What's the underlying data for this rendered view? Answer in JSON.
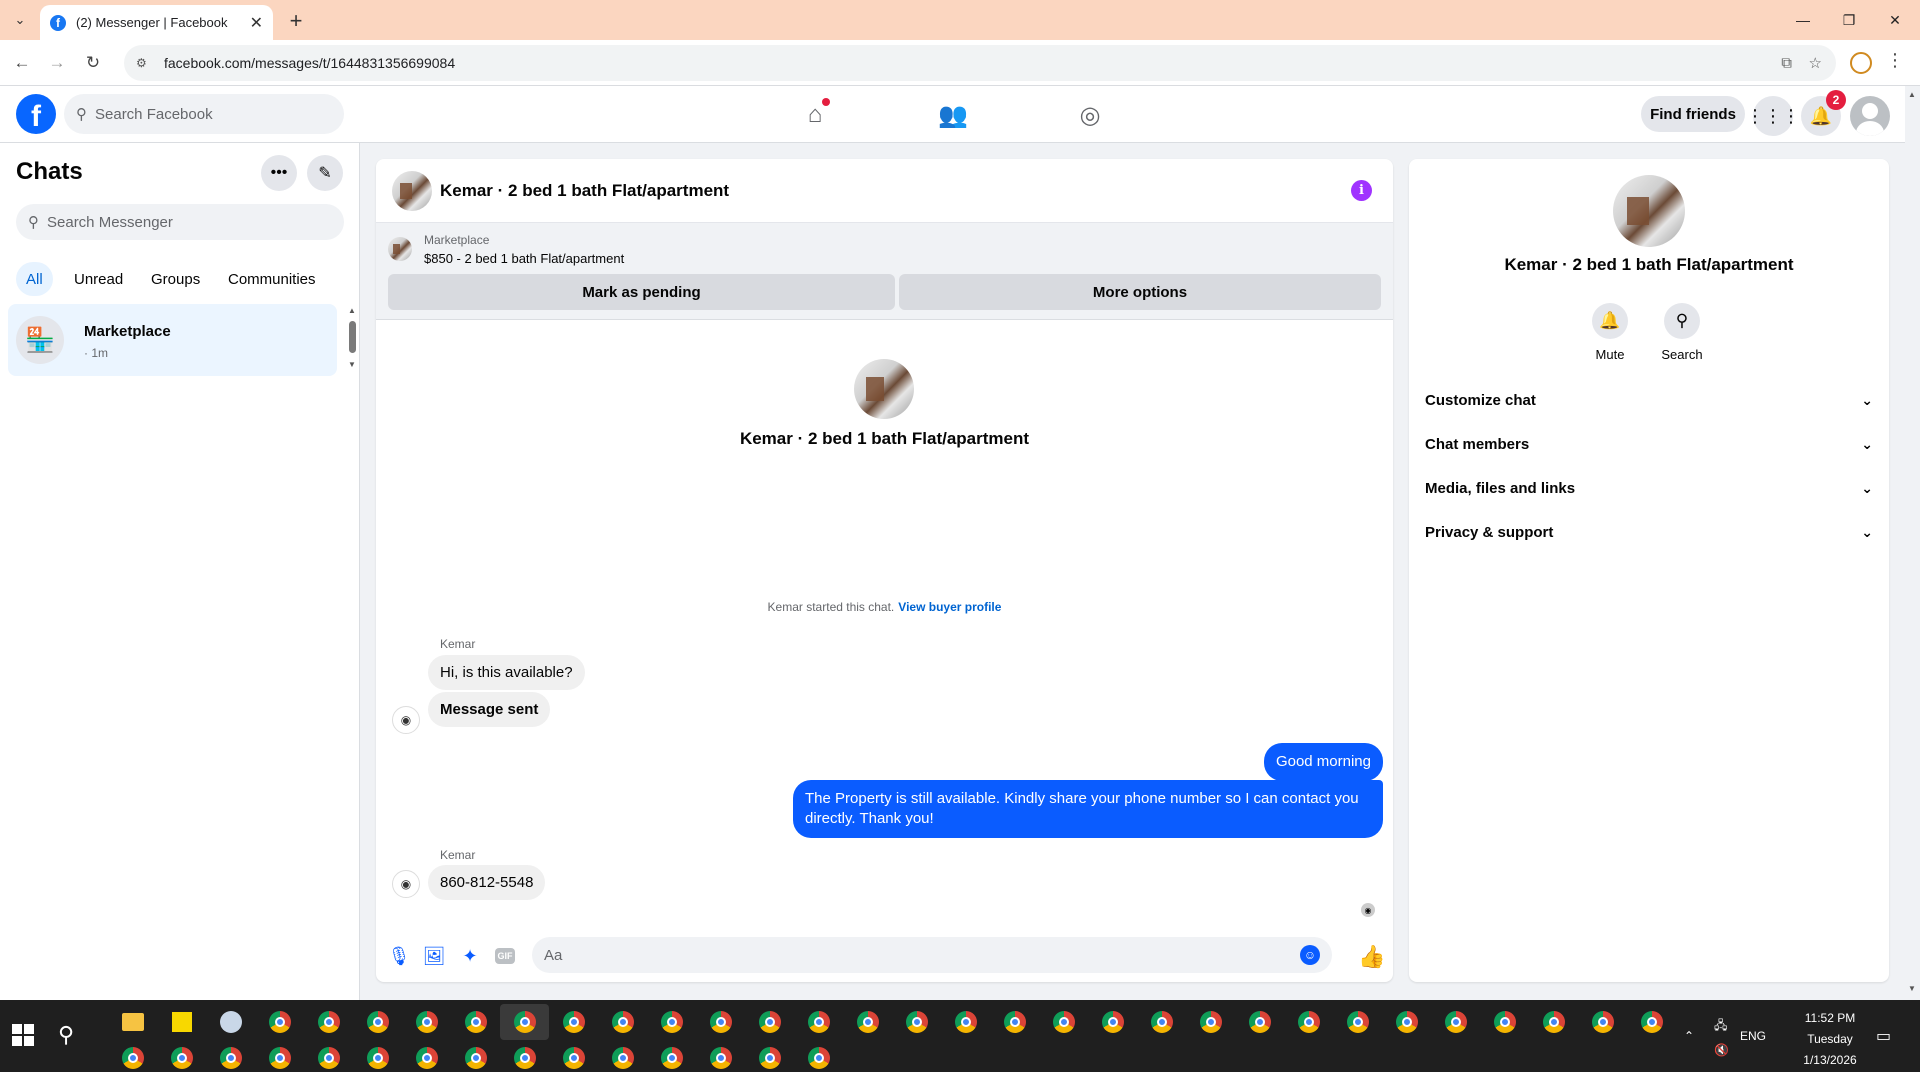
{
  "browser": {
    "tab_title": "(2) Messenger | Facebook",
    "url": "facebook.com/messages/t/1644831356699084"
  },
  "fb": {
    "search_placeholder": "Search Facebook",
    "find_friends": "Find friends",
    "notification_count": "2"
  },
  "chats": {
    "title": "Chats",
    "search_placeholder": "Search Messenger",
    "filters": [
      "All",
      "Unread",
      "Groups",
      "Communities"
    ],
    "items": [
      {
        "name": "Marketplace",
        "time": "· 1m"
      }
    ]
  },
  "conversation": {
    "title": "Kemar · 2 bed 1 bath Flat/apartment",
    "marketplace_label": "Marketplace",
    "listing": "$850 - 2 bed 1 bath Flat/apartment",
    "mark_pending": "Mark as pending",
    "more_options": "More options",
    "intro_name": "Kemar · 2 bed 1 bath Flat/apartment",
    "started_text": "Kemar started this chat.",
    "view_buyer_profile": "View buyer profile",
    "messages": [
      {
        "sender": "Kemar",
        "text": "Hi, is this available?"
      },
      {
        "text": "Message sent"
      },
      {
        "text": "Good morning"
      },
      {
        "text": "The Property is still available. Kindly share your phone number so I can contact you directly. Thank you!"
      },
      {
        "sender": "Kemar",
        "text": "860-812-5548"
      }
    ],
    "composer_placeholder": "Aa",
    "gif_label": "GIF"
  },
  "details": {
    "name": "Kemar · 2 bed 1 bath Flat/apartment",
    "actions": [
      "Mute",
      "Search"
    ],
    "sections": [
      "Customize chat",
      "Chat members",
      "Media, files and links",
      "Privacy & support"
    ]
  },
  "taskbar": {
    "language": "ENG",
    "time": "11:52 PM",
    "day": "Tuesday",
    "date": "1/13/2026"
  },
  "colors": {
    "brand_blue": "#0866ff",
    "outgoing_bubble": "#0a5cff",
    "info_purple": "#a033ff",
    "notification_red": "#e41e3f",
    "tabstrip": "#fbd6c0"
  }
}
